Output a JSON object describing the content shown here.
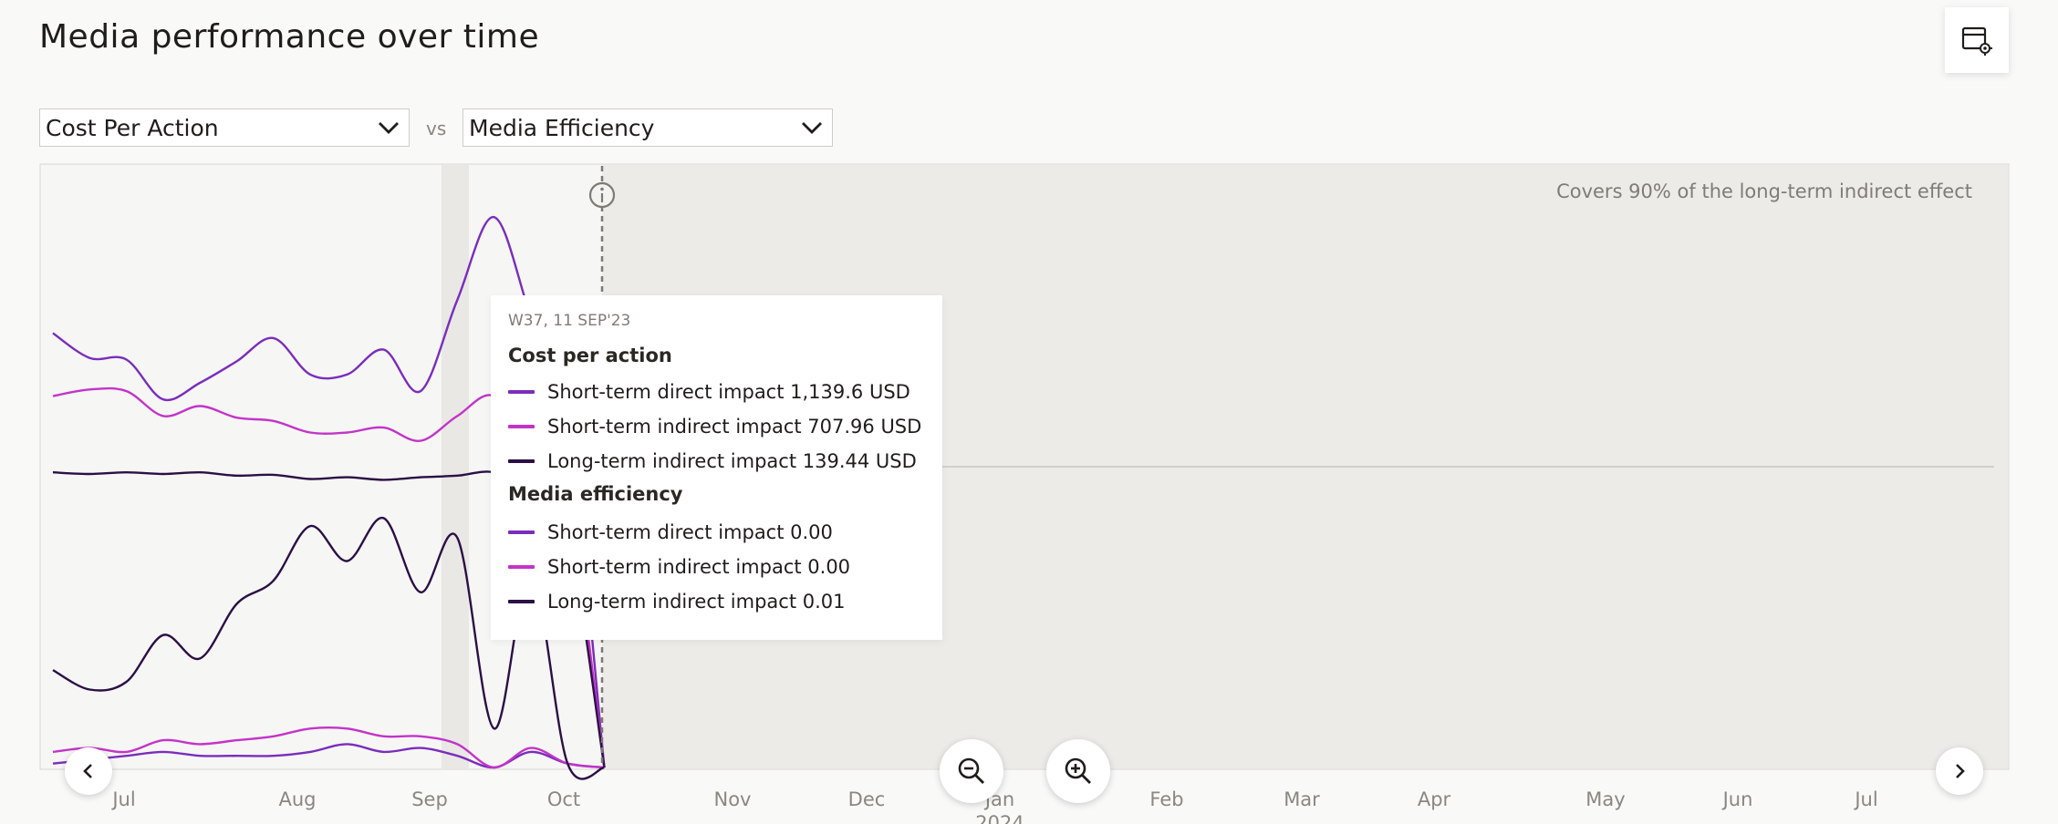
{
  "page": {
    "title": "Media performance over time"
  },
  "controls": {
    "metric_a": "Cost Per Action",
    "vs": "vs",
    "metric_b": "Media Efficiency",
    "settings_icon": "table-settings-icon",
    "prev_icon": "chevron-left-icon",
    "next_icon": "chevron-right-icon",
    "zoom_out_icon": "zoom-out-icon",
    "zoom_in_icon": "zoom-in-icon"
  },
  "chart_data": {
    "type": "line",
    "x_tick_labels": [
      "Jul",
      "Aug",
      "Sep",
      "Oct",
      "Nov",
      "Dec",
      "Jan",
      "Feb",
      "Mar",
      "Apr",
      "May",
      "Jun",
      "Jul"
    ],
    "x_tick_sublabel": "2024",
    "x_tick_sublabel_under": "Jan",
    "annotation": "Covers 90% of the long-term indirect effect",
    "x": [
      "2023-06-19",
      "2023-06-26",
      "2023-07-03",
      "2023-07-10",
      "2023-07-17",
      "2023-07-24",
      "2023-07-31",
      "2023-08-07",
      "2023-08-14",
      "2023-08-21",
      "2023-08-28",
      "2023-09-04",
      "2023-09-11",
      "2023-09-18",
      "2023-09-25",
      "2023-10-02"
    ],
    "long_term_window_start": "2023-10-02",
    "panels": [
      {
        "metric": "Cost per action",
        "series": [
          {
            "name": "Short-term direct impact",
            "color": "#7a2dbb",
            "values": [
              1400,
              1250,
              1240,
              1000,
              1100,
              1230,
              1370,
              1150,
              1150,
              1300,
              1050,
              1600,
              2100,
              1500,
              900,
              0
            ]
          },
          {
            "name": "Short-term indirect impact",
            "color": "#c334c8",
            "values": [
              1020,
              1060,
              1050,
              900,
              960,
              890,
              870,
              800,
              800,
              830,
              750,
              900,
              1020,
              700,
              400,
              0
            ]
          },
          {
            "name": "Long-term indirect impact",
            "color": "#2b0f45",
            "values": [
              560,
              550,
              560,
              550,
              560,
              540,
              545,
              520,
              530,
              515,
              530,
              540,
              560,
              450,
              200,
              0
            ]
          }
        ]
      },
      {
        "metric": "Media efficiency",
        "series": [
          {
            "name": "Short-term direct impact",
            "color": "#7a2dbb",
            "values": [
              0.001,
              0.002,
              0.003,
              0.004,
              0.003,
              0.003,
              0.003,
              0.004,
              0.006,
              0.004,
              0.005,
              0.003,
              0.0,
              0.004,
              0.001,
              0
            ]
          },
          {
            "name": "Short-term indirect impact",
            "color": "#c334c8",
            "values": [
              0.004,
              0.005,
              0.004,
              0.007,
              0.006,
              0.007,
              0.008,
              0.01,
              0.01,
              0.008,
              0.008,
              0.006,
              0.0,
              0.005,
              0.001,
              0
            ]
          },
          {
            "name": "Long-term indirect impact",
            "color": "#2b0f45",
            "values": [
              0.025,
              0.02,
              0.022,
              0.034,
              0.028,
              0.042,
              0.048,
              0.062,
              0.053,
              0.064,
              0.045,
              0.059,
              0.01,
              0.05,
              0.001,
              0
            ]
          }
        ]
      }
    ]
  },
  "tooltip": {
    "date": "W37, 11 SEP'23",
    "section1_title": "Cost per action",
    "section1_rows": [
      {
        "label": "Short-term direct impact 1,139.6 USD",
        "color": "#7a2dbb"
      },
      {
        "label": "Short-term indirect impact 707.96 USD",
        "color": "#c334c8"
      },
      {
        "label": "Long-term indirect impact 139.44 USD",
        "color": "#2b0f45"
      }
    ],
    "section2_title": "Media efficiency",
    "section2_rows": [
      {
        "label": "Short-term direct impact 0.00",
        "color": "#7a2dbb"
      },
      {
        "label": "Short-term indirect impact 0.00",
        "color": "#c334c8"
      },
      {
        "label": "Long-term indirect impact 0.01",
        "color": "#2b0f45"
      }
    ]
  }
}
